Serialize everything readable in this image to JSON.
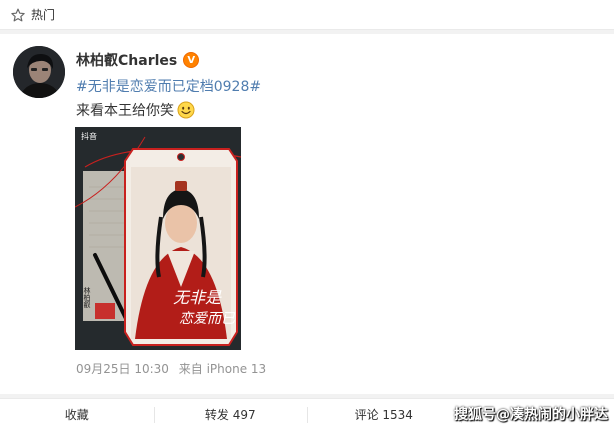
{
  "top_bar": {
    "label": "热门",
    "icon": "star-outline-icon"
  },
  "post": {
    "username": "林柏叡Charles",
    "badge": "V",
    "topic": "#无非是恋爱而已定档0928#",
    "text": "来看本王给你笑",
    "emoji": "smile-emoji",
    "image": {
      "douyin_logo": "抖音",
      "title_line1": "无非是",
      "title_line2": "恋爱而已",
      "side_name": "林柏叡",
      "colors": {
        "background": "#2b2f33",
        "frame": "#c8211f",
        "robe": "#b21d18"
      }
    },
    "date": "09月25日 10:30",
    "source": "来自 iPhone 13"
  },
  "actions": {
    "collect": "收藏",
    "repost": "转发 497",
    "comment": "评论 1534"
  },
  "watermark": "搜狐号@凑热闹的小胖达",
  "colors": {
    "link": "#507daf",
    "badge": "#ff8200",
    "meta": "#939393"
  }
}
